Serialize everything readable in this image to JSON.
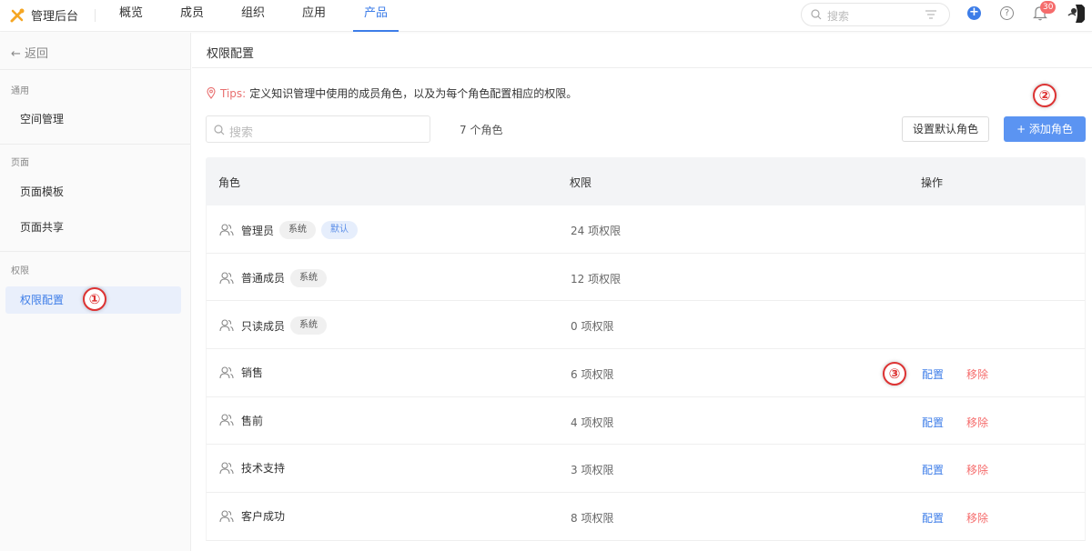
{
  "topbar": {
    "app_title": "管理后台",
    "tabs": [
      {
        "label": "概览",
        "active": false
      },
      {
        "label": "成员",
        "active": false
      },
      {
        "label": "组织",
        "active": false
      },
      {
        "label": "应用",
        "active": false
      },
      {
        "label": "产品",
        "active": true
      }
    ],
    "search_placeholder": "搜索",
    "notification_count": "30",
    "accent_color": "#3d7de8"
  },
  "sidebar": {
    "back_label": "← 返回",
    "sections": [
      {
        "title": "通用",
        "items": [
          {
            "label": "空间管理",
            "active": false
          }
        ]
      },
      {
        "title": "页面",
        "items": [
          {
            "label": "页面模板",
            "active": false
          },
          {
            "label": "页面共享",
            "active": false
          }
        ]
      },
      {
        "title": "权限",
        "items": [
          {
            "label": "权限配置",
            "active": true
          }
        ]
      }
    ]
  },
  "markers": [
    "①",
    "②",
    "③"
  ],
  "main": {
    "page_title": "权限配置",
    "tips_label": "Tips:",
    "tips_text": "定义知识管理中使用的成员角色，以及为每个角色配置相应的权限。",
    "search_placeholder": "搜索",
    "role_count": "7 个角色",
    "set_default_button": "设置默认角色",
    "add_role_button": "+ 添加角色",
    "table": {
      "headers": [
        "角色",
        "权限",
        "操作"
      ],
      "rows": [
        {
          "name": "管理员",
          "tags": [
            "系统",
            "默认"
          ],
          "permissions": "24 项权限",
          "actions": []
        },
        {
          "name": "普通成员",
          "tags": [
            "系统"
          ],
          "permissions": "12 项权限",
          "actions": []
        },
        {
          "name": "只读成员",
          "tags": [
            "系统"
          ],
          "permissions": "0 项权限",
          "actions": []
        },
        {
          "name": "销售",
          "tags": [],
          "permissions": "6 项权限",
          "actions": [
            "配置",
            "移除"
          ]
        },
        {
          "name": "售前",
          "tags": [],
          "permissions": "4 项权限",
          "actions": [
            "配置",
            "移除"
          ]
        },
        {
          "name": "技术支持",
          "tags": [],
          "permissions": "3 项权限",
          "actions": [
            "配置",
            "移除"
          ]
        },
        {
          "name": "客户成功",
          "tags": [],
          "permissions": "8 项权限",
          "actions": [
            "配置",
            "移除"
          ]
        }
      ]
    }
  }
}
